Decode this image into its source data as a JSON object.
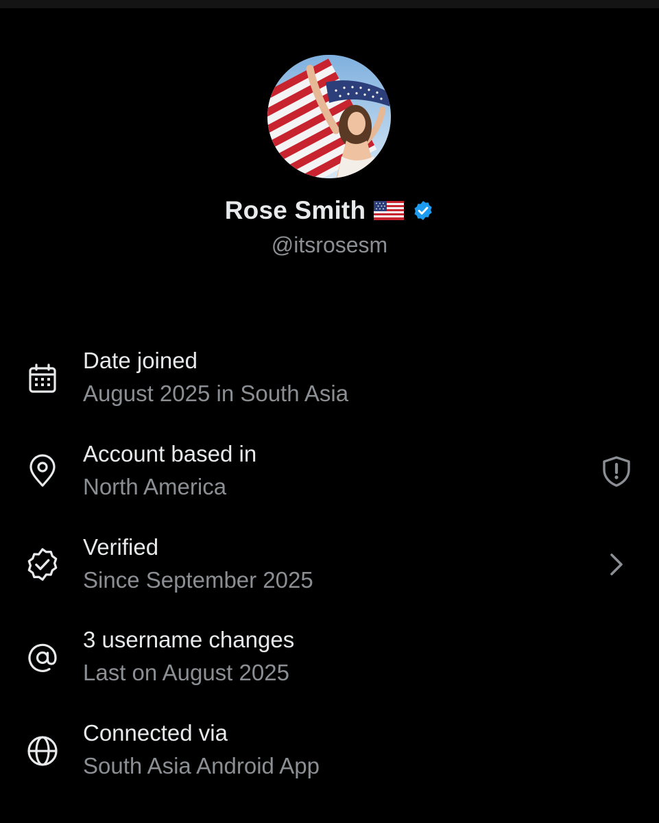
{
  "profile": {
    "display_name": "Rose Smith",
    "handle": "@itsrosesm",
    "flag_emoji": "🇺🇸",
    "verified": true,
    "avatar_icon": "profile-photo-woman-with-american-flag"
  },
  "about": {
    "rows": [
      {
        "id": "date-joined",
        "icon": "calendar-icon",
        "title": "Date joined",
        "subtitle": "August 2025 in South Asia"
      },
      {
        "id": "account-based-in",
        "icon": "location-pin-icon",
        "title": "Account based in",
        "subtitle": "North America",
        "action_icon": "shield-alert-icon"
      },
      {
        "id": "verified",
        "icon": "verified-badge-outline-icon",
        "title": "Verified",
        "subtitle": "Since September 2025",
        "action_icon": "chevron-right-icon"
      },
      {
        "id": "username-changes",
        "icon": "at-sign-icon",
        "title": "3 username changes",
        "subtitle": "Last on August 2025"
      },
      {
        "id": "connected-via",
        "icon": "globe-icon",
        "title": "Connected via",
        "subtitle": "South Asia Android App"
      }
    ]
  },
  "colors": {
    "background": "#000000",
    "primary_text": "#e7e9ea",
    "secondary_text": "#8b8f94",
    "verified_blue": "#1d9bf0",
    "icon_color": "#e7e9ea",
    "action_icon_color": "#8b8f94"
  }
}
